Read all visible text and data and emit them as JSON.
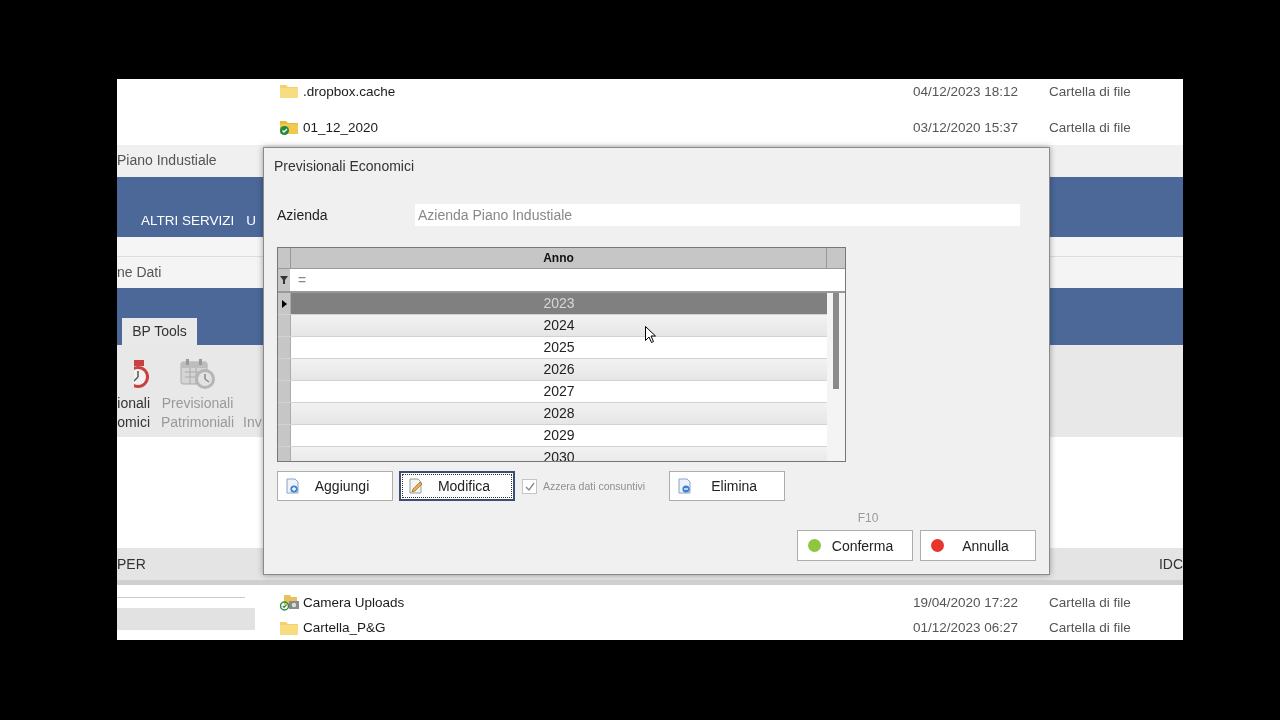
{
  "explorer": {
    "rows_top": [
      {
        "kind": "folder",
        "name": ".dropbox.cache",
        "date": "04/12/2023 18:12",
        "type": "Cartella di file"
      },
      {
        "kind": "synced-folder",
        "name": "01_12_2020",
        "date": "03/12/2020 15:37",
        "type": "Cartella di file"
      }
    ],
    "rows_bottom": [
      {
        "kind": "camera-folder",
        "name": "Camera Uploads",
        "date": "19/04/2020 17:22",
        "type": "Cartella di file"
      },
      {
        "kind": "folder",
        "name": "Cartella_P&G",
        "date": "01/12/2023 06:27",
        "type": "Cartella di file"
      }
    ]
  },
  "app": {
    "title": "Piano Industiale",
    "tabs": [
      {
        "label": "ALTRI SERVIZI",
        "selected": false
      },
      {
        "label": "U",
        "selected": false
      }
    ],
    "group_label": "ne Dati",
    "ribbon_tabs": [
      {
        "label": "BP Tools",
        "selected": true
      }
    ],
    "tools": [
      {
        "kind": "alarm-clock",
        "lines": [
          "ionali",
          "omici"
        ],
        "disabled": false
      },
      {
        "kind": "calendar-clock",
        "lines": [
          "Previsionali",
          "Patrimoniali"
        ],
        "disabled": true
      },
      {
        "kind": "label-only",
        "lines": [
          "Inv"
        ],
        "disabled": true
      }
    ],
    "columns": [
      "PER",
      "IDC"
    ]
  },
  "dialog": {
    "title": "Previsionali Economici",
    "company": {
      "label": "Azienda",
      "value": "Azienda Piano Industiale"
    },
    "grid": {
      "column": "Anno",
      "filter": "=",
      "rows": [
        {
          "value": "2023",
          "selected": true
        },
        {
          "value": "2024",
          "selected": false
        },
        {
          "value": "2025",
          "selected": false
        },
        {
          "value": "2026",
          "selected": false
        },
        {
          "value": "2027",
          "selected": false
        },
        {
          "value": "2028",
          "selected": false
        },
        {
          "value": "2029",
          "selected": false
        },
        {
          "value": "2030",
          "selected": false
        }
      ]
    },
    "actions": [
      {
        "kind": "add",
        "label": "Aggiungi",
        "focused": false
      },
      {
        "kind": "edit",
        "label": "Modifica",
        "focused": true
      },
      {
        "kind": "checkbox",
        "label": "Azzera dati consuntivi",
        "checked": true,
        "disabled": true
      },
      {
        "kind": "delete",
        "label": "Elimina",
        "focused": false
      }
    ],
    "shortcut_hint": "F10",
    "footer": [
      {
        "label": "Conferma",
        "color": "#8dc63f"
      },
      {
        "label": "Annulla",
        "color": "#e8352b"
      }
    ]
  }
}
